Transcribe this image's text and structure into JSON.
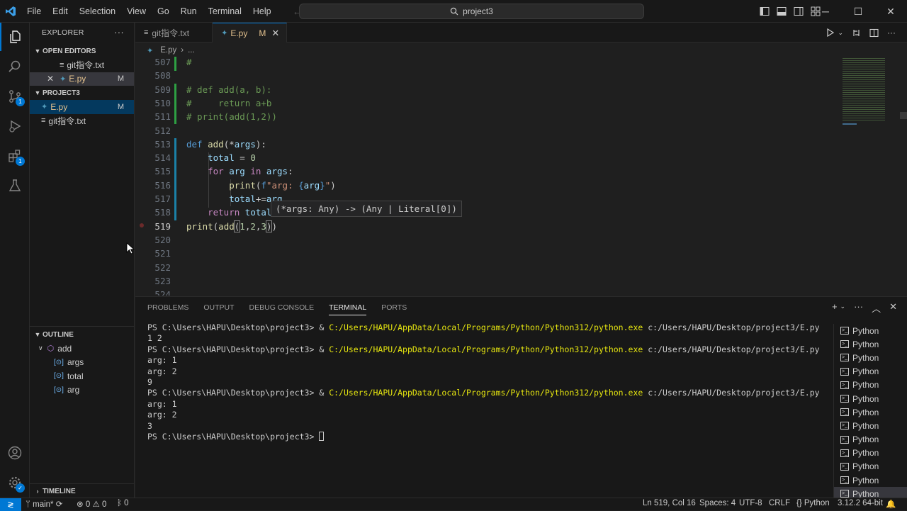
{
  "menu": [
    "File",
    "Edit",
    "Selection",
    "View",
    "Go",
    "Run",
    "Terminal",
    "Help"
  ],
  "search": {
    "text": "project3"
  },
  "activity_badges": {
    "source_control": "1",
    "extensions": "1"
  },
  "explorer": {
    "title": "EXPLORER",
    "open_editors_label": "OPEN EDITORS",
    "open_editors": [
      {
        "name": "git指令.txt",
        "modified": ""
      },
      {
        "name": "E.py",
        "modified": "M"
      }
    ],
    "project_label": "PROJECT3",
    "files": [
      {
        "name": "E.py",
        "modified": "M"
      },
      {
        "name": "git指令.txt",
        "modified": ""
      }
    ],
    "outline_label": "OUTLINE",
    "outline": {
      "function": "add",
      "children": [
        "args",
        "total",
        "arg"
      ]
    },
    "timeline_label": "TIMELINE"
  },
  "tabs": [
    {
      "label": "git指令.txt",
      "modified": ""
    },
    {
      "label": "E.py",
      "modified": "M"
    }
  ],
  "breadcrumb": {
    "file": "E.py",
    "rest": "..."
  },
  "code": {
    "line_numbers": [
      "507",
      "508",
      "509",
      "510",
      "511",
      "512",
      "513",
      "514",
      "515",
      "516",
      "517",
      "518",
      "519",
      "520",
      "521",
      "522",
      "523",
      "524"
    ],
    "hover": "(*args: Any) -> (Any | Literal[0])"
  },
  "panel": {
    "tabs": [
      "PROBLEMS",
      "OUTPUT",
      "DEBUG CONSOLE",
      "TERMINAL",
      "PORTS"
    ],
    "active_tab": "TERMINAL",
    "prompt": "PS C:\\Users\\HAPU\\Desktop\\project3> & ",
    "exe": "C:/Users/HAPU/AppData/Local/Programs/Python/Python312/python.exe",
    "script": " c:/Users/HAPU/Desktop/project3/E.py",
    "out1": "1 2",
    "out2": [
      "arg: 1",
      "arg: 2",
      "9"
    ],
    "out3": [
      "arg: 1",
      "arg: 2",
      "3"
    ],
    "final_prompt": "PS C:\\Users\\HAPU\\Desktop\\project3> ",
    "terminals": [
      "Python",
      "Python",
      "Python",
      "Python",
      "Python",
      "Python",
      "Python",
      "Python",
      "Python",
      "Python",
      "Python",
      "Python",
      "Python"
    ]
  },
  "status": {
    "branch": "main*",
    "errors": "0",
    "warnings": "0",
    "ports": "0",
    "position": "Ln 519, Col 16",
    "spaces": "Spaces: 4",
    "encoding": "UTF-8",
    "eol": "CRLF",
    "language": "Python",
    "interpreter": "3.12.2 64-bit"
  },
  "colors": {
    "accent": "#0078d4",
    "modified": "#e2c08d",
    "terminal_path": "#e5e510"
  }
}
